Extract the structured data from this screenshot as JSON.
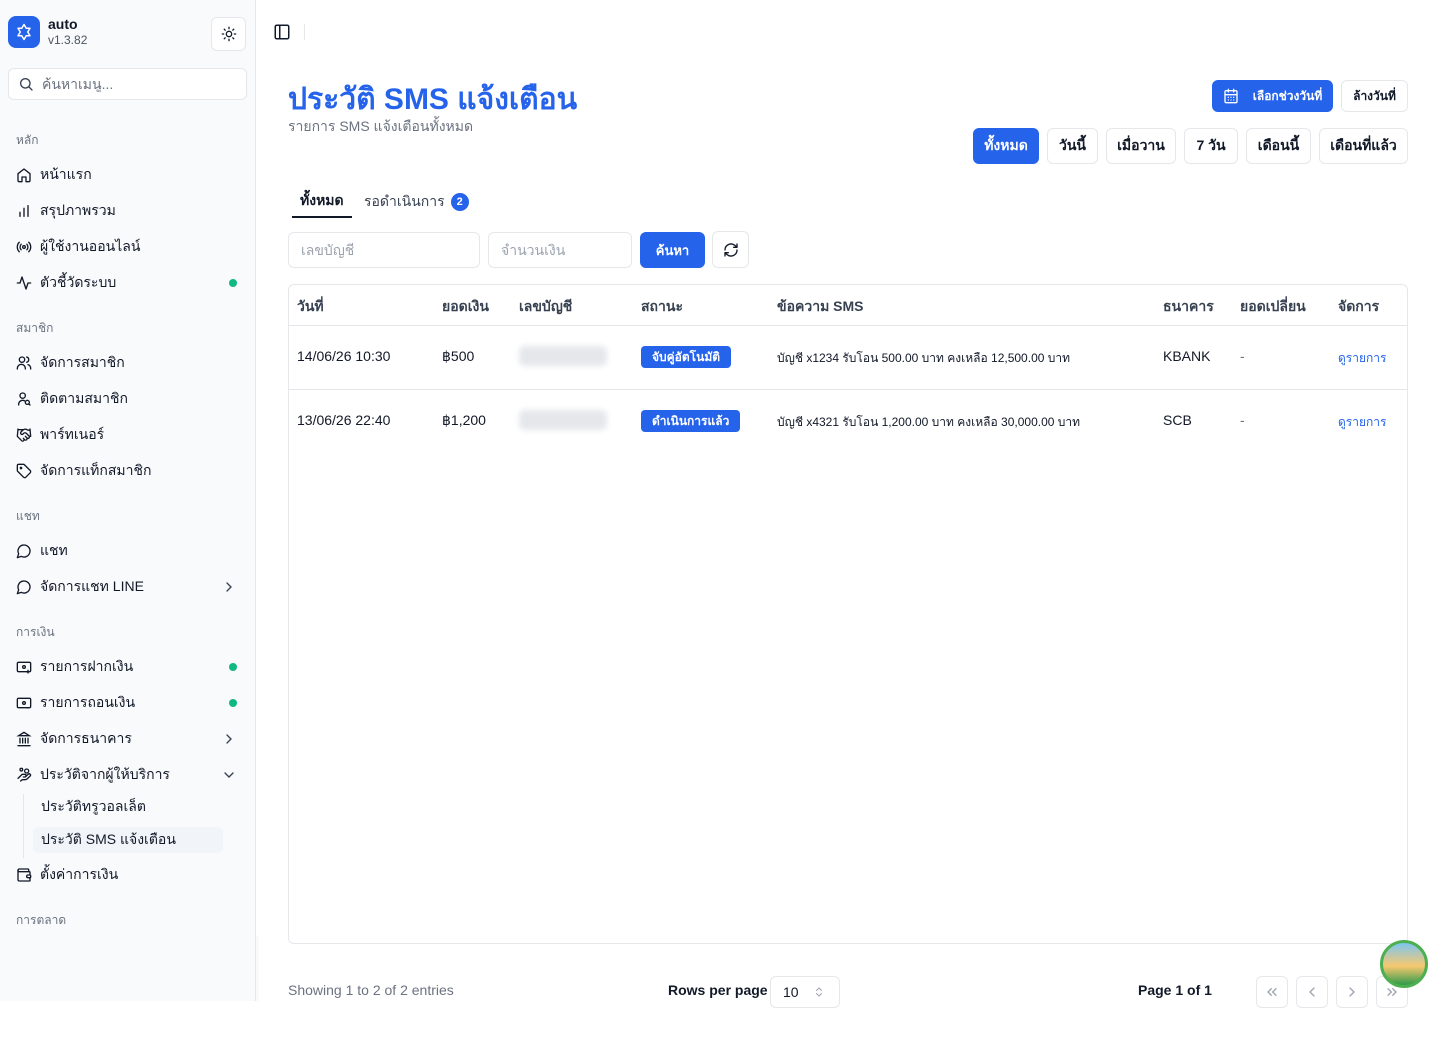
{
  "brand": {
    "name": "auto",
    "version": "v1.3.82"
  },
  "sidebar": {
    "search_placeholder": "ค้นหาเมนู...",
    "groups": [
      {
        "label": "หลัก",
        "items": [
          {
            "label": "หน้าแรก",
            "icon": "home-icon"
          },
          {
            "label": "สรุปภาพรวม",
            "icon": "bar-chart-icon"
          },
          {
            "label": "ผู้ใช้งานออนไลน์",
            "icon": "radio-icon"
          },
          {
            "label": "ตัวชี้วัดระบบ",
            "icon": "activity-icon",
            "status_dot": true
          }
        ]
      },
      {
        "label": "สมาชิก",
        "items": [
          {
            "label": "จัดการสมาชิก",
            "icon": "users-icon"
          },
          {
            "label": "ติดตามสมาชิก",
            "icon": "user-search-icon"
          },
          {
            "label": "พาร์ทเนอร์",
            "icon": "handshake-icon"
          },
          {
            "label": "จัดการแท็กสมาชิก",
            "icon": "tag-icon"
          }
        ]
      },
      {
        "label": "แชท",
        "items": [
          {
            "label": "แชท",
            "icon": "message-circle-icon"
          },
          {
            "label": "จัดการแชท LINE",
            "icon": "message-circle-icon",
            "chevron": "right"
          }
        ]
      },
      {
        "label": "การเงิน",
        "items": [
          {
            "label": "รายการฝากเงิน",
            "icon": "deposit-icon",
            "status_dot": true
          },
          {
            "label": "รายการถอนเงิน",
            "icon": "withdraw-icon",
            "status_dot": true
          },
          {
            "label": "จัดการธนาคาร",
            "icon": "bank-icon",
            "chevron": "right"
          },
          {
            "label": "ประวัติจากผู้ให้บริการ",
            "icon": "hand-coins-icon",
            "chevron": "down"
          }
        ]
      },
      {
        "label": "การตลาด",
        "items": []
      }
    ],
    "sub_items": [
      {
        "label": "ประวัติทรูวอลเล็ต",
        "active": false
      },
      {
        "label": "ประวัติ SMS แจ้งเตือน",
        "active": true
      }
    ],
    "extra_item": {
      "label": "ตั้งค่าการเงิน",
      "icon": "wallet-icon"
    }
  },
  "header": {
    "title": "ประวัติ SMS แจ้งเตือน",
    "subtitle": "รายการ SMS แจ้งเตือนทั้งหมด",
    "date_range_button": "เลือกช่วงวันที่",
    "clear_date_button": "ล้างวันที่",
    "quick_filters": [
      "ทั้งหมด",
      "วันนี้",
      "เมื่อวาน",
      "7 วัน",
      "เดือนนี้",
      "เดือนที่แล้ว"
    ],
    "active_quick_filter": "ทั้งหมด"
  },
  "tabs": [
    {
      "label": "ทั้งหมด",
      "active": true
    },
    {
      "label": "รอดำเนินการ",
      "badge": "2",
      "active": false
    }
  ],
  "filters": {
    "account_placeholder": "เลขบัญชี",
    "amount_placeholder": "จำนวนเงิน",
    "search_button": "ค้นหา"
  },
  "table": {
    "columns": [
      "วันที่",
      "ยอดเงิน",
      "เลขบัญชี",
      "สถานะ",
      "ข้อความ SMS",
      "ธนาคาร",
      "ยอดเปลี่ยน",
      "จัดการ"
    ],
    "rows": [
      {
        "date": "14/06/26 10:30",
        "amount": "฿500",
        "account": "(hidden)",
        "status": "จับคู่อัตโนมัติ",
        "sms": "บัญชี x1234 รับโอน 500.00 บาท คงเหลือ 12,500.00 บาท",
        "bank": "KBANK",
        "change": "-",
        "action": "ดูรายการ"
      },
      {
        "date": "13/06/26 22:40",
        "amount": "฿1,200",
        "account": "(hidden)",
        "status": "ดำเนินการแล้ว",
        "sms": "บัญชี x4321 รับโอน 1,200.00 บาท คงเหลือ 30,000.00 บาท",
        "bank": "SCB",
        "change": "-",
        "action": "ดูรายการ"
      }
    ]
  },
  "footer": {
    "showing": "Showing 1 to 2 of 2 entries",
    "rows_per_page_label": "Rows per page",
    "rows_per_page_value": "10",
    "page_info": "Page 1 of 1"
  },
  "colors": {
    "accent": "#2563eb",
    "status_dot": "#10b981"
  }
}
